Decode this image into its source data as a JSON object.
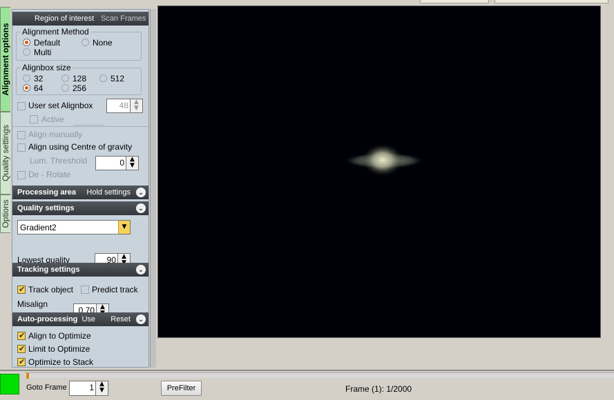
{
  "vertical_tabs": [
    "Alignment options",
    "Quality settings",
    "Options"
  ],
  "panel": {
    "roi_header": {
      "label": "Region of interest",
      "scan_label": "Scan Frames"
    },
    "alignment_method": {
      "legend": "Alignment Method",
      "options": [
        "Default",
        "None",
        "Multi"
      ],
      "selected": "Default"
    },
    "alignbox_size": {
      "legend": "Alignbox size",
      "options": [
        "32",
        "128",
        "512",
        "64",
        "256"
      ],
      "selected": "64"
    },
    "user_set_alignbox": {
      "label": "User set Alignbox",
      "value": "48",
      "active_label": "Active"
    },
    "align_manually": "Align manually",
    "align_cog": "Align using Centre of gravity",
    "lum_threshold": {
      "label": "Lum. Threshold",
      "value": "0"
    },
    "de_rotate": "De - Rotate",
    "processing_area": {
      "label": "Processing area",
      "hold_label": "Hold settings"
    },
    "quality_settings": {
      "label": "Quality settings",
      "method": "Gradient2",
      "lowest_quality_label": "Lowest quality",
      "lowest_quality_value": "90"
    },
    "tracking_settings": {
      "label": "Tracking settings",
      "track_object": "Track object",
      "predict_track": "Predict track",
      "misalign_label": "Misalign",
      "misalign_value": "0.70"
    },
    "auto_processing": {
      "label": "Auto-processing",
      "use_label": "Use",
      "reset_label": "Reset",
      "items": [
        "Align to Optimize",
        "Limit to Optimize",
        "Optimize to Stack"
      ]
    }
  },
  "bottom": {
    "goto_label": "Goto Frame",
    "goto_value": "1",
    "prefilter_label": "PreFilter",
    "frame_status": "Frame (1): 1/2000",
    "timeline_progress": 0.0005
  },
  "colors": {
    "accent_orange": "#d65a00",
    "status_green": "#00e000",
    "tab_active": "#9be39b"
  }
}
